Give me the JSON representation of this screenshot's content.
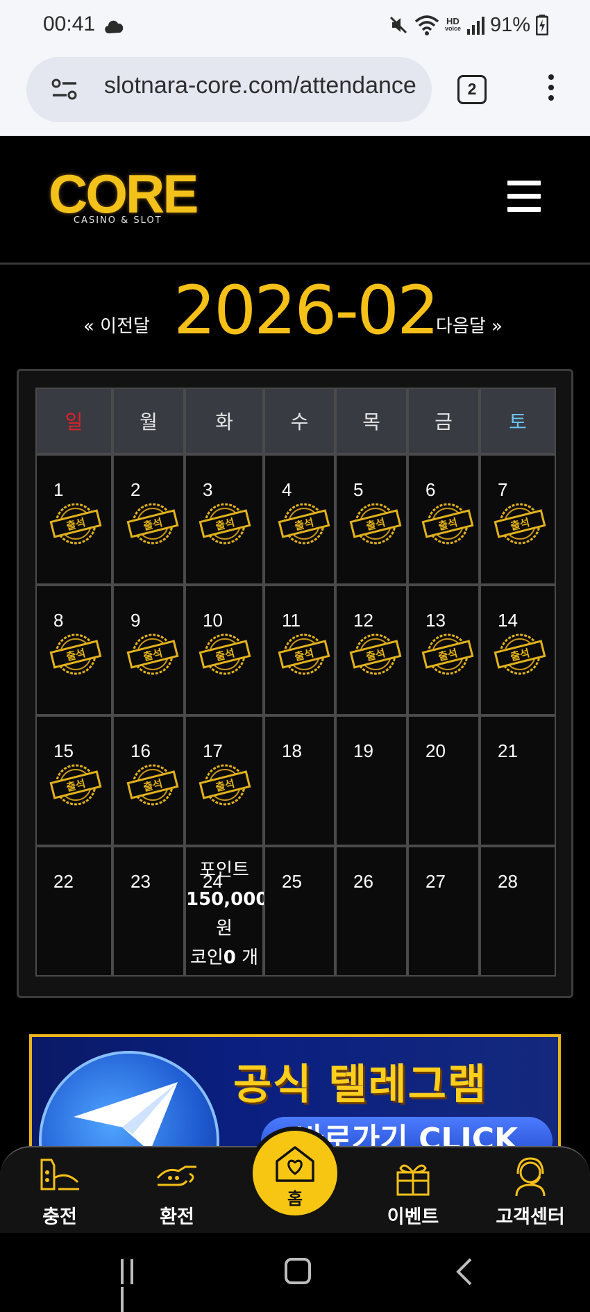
{
  "status_bar": {
    "time": "00:41",
    "battery": "91%",
    "hd_line1": "HD",
    "hd_line2": "voice"
  },
  "browser": {
    "url": "slotnara-core.com/attendance",
    "tab_count": "2"
  },
  "site": {
    "logo_text": "CORE",
    "logo_sub": "CASINO & SLOT"
  },
  "calendar": {
    "prev_label": "« 이전달",
    "next_label": "다음달 »",
    "month_title": "2026-02",
    "weekdays": [
      "일",
      "월",
      "화",
      "수",
      "목",
      "금",
      "토"
    ],
    "attended_days": [
      1,
      2,
      3,
      4,
      5,
      6,
      7,
      8,
      9,
      10,
      11,
      12,
      13,
      14,
      15,
      16,
      17
    ],
    "weeks": [
      [
        "1",
        "2",
        "3",
        "4",
        "5",
        "6",
        "7"
      ],
      [
        "8",
        "9",
        "10",
        "11",
        "12",
        "13",
        "14"
      ],
      [
        "15",
        "16",
        "17",
        "18",
        "19",
        "20",
        "21"
      ],
      [
        "22",
        "23",
        "24",
        "25",
        "26",
        "27",
        "28"
      ]
    ],
    "stamp_text": "출석",
    "today": {
      "day": "24",
      "point_label": "포인트",
      "point_value": "150,000",
      "point_unit": "원",
      "coin_label": "코인",
      "coin_value": "0",
      "coin_unit": "개"
    }
  },
  "banner": {
    "title": "공식 텔레그램",
    "subtitle": "바로가기 CLICK"
  },
  "bottom_nav": {
    "items": [
      {
        "label": "충전",
        "icon": "deposit-icon"
      },
      {
        "label": "환전",
        "icon": "withdraw-icon"
      },
      {
        "label": "홈",
        "icon": "home-heart-icon"
      },
      {
        "label": "이벤트",
        "icon": "gift-icon"
      },
      {
        "label": "고객센터",
        "icon": "support-icon"
      }
    ]
  },
  "colors": {
    "accent": "#f5c018",
    "sunday": "#e0202a",
    "saturday": "#6ec2f0",
    "background": "#000000"
  }
}
